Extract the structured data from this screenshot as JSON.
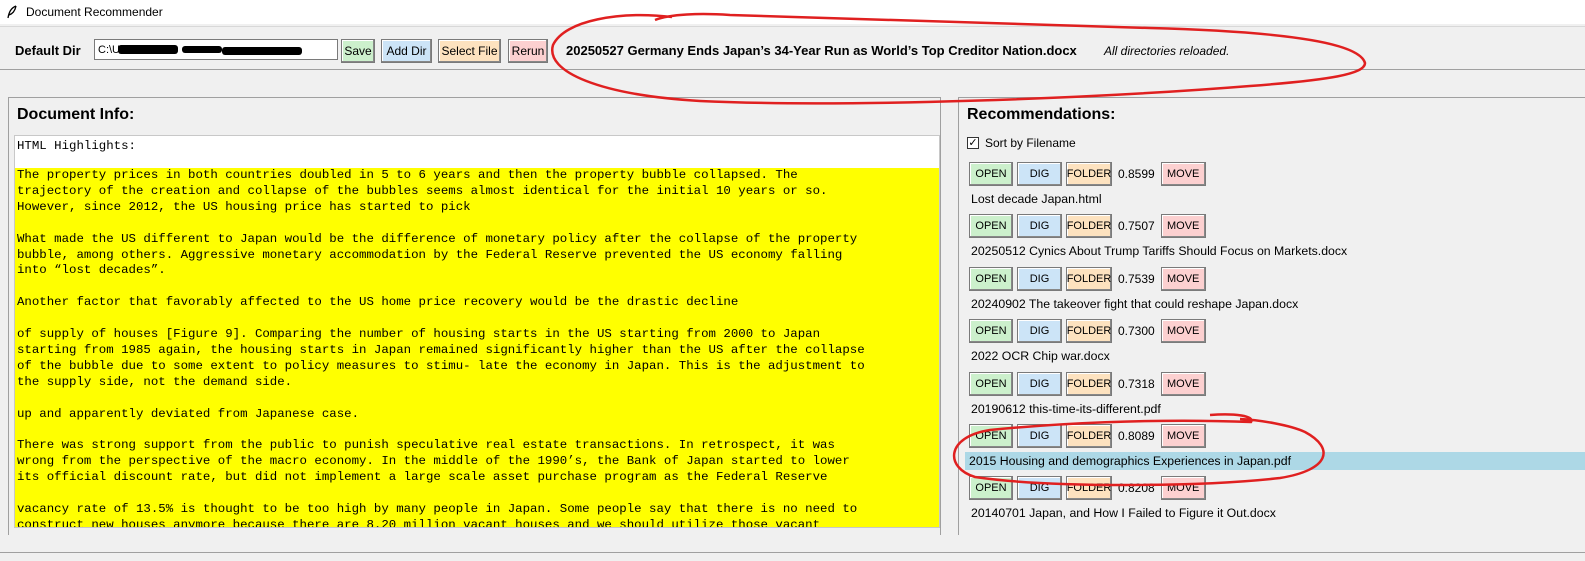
{
  "window": {
    "title": "Document Recommender",
    "icon": "feather-icon"
  },
  "toolbar": {
    "default_dir_label": "Default Dir",
    "default_dir_value": "C:\\U",
    "save_label": "Save",
    "add_dir_label": "Add Dir",
    "select_file_label": "Select File",
    "rerun_label": "Rerun",
    "current_file": "20250527 Germany Ends Japan’s 34-Year Run as World’s Top Creditor Nation.docx",
    "status": "All directories reloaded.",
    "colors": {
      "save": "#ccf0cc",
      "add_dir": "#cce4f7",
      "select_file": "#fde2bf",
      "rerun": "#fcd0d0"
    }
  },
  "document_info": {
    "heading": "Document Info:",
    "text_header": "HTML Highlights:",
    "highlight_color": "#ffff00",
    "paragraphs": [
      [
        "The property prices in both countries doubled in 5 to 6 years and then the property bubble collapsed. The",
        "trajectory of the creation and collapse of the bubbles seems almost identical for the initial 10 years or so.",
        "However, since 2012, the US housing price has started to pick"
      ],
      [
        "What made the US different to Japan would be the difference of monetary policy after the collapse of the property",
        "bubble, among others. Aggressive monetary accommodation by the Federal Reserve prevented the US economy falling",
        "into “lost decades”."
      ],
      [
        "Another factor that favorably affected to the US home price recovery would be the drastic decline"
      ],
      [
        "of supply of houses [Figure 9]. Comparing the number of housing starts in the US starting from 2000 to Japan",
        "starting from 1985 again, the housing starts in Japan remained significantly higher than the US after the collapse",
        "of the bubble due to some extent to policy measures to stimu- late the economy in Japan. This is the adjustment to",
        "the supply side, not the demand side."
      ],
      [
        "up and apparently deviated from Japanese case."
      ],
      [
        "There was strong support from the public to punish speculative real estate transactions. In retrospect, it was",
        "wrong from the perspective of the macro economy. In the middle of the 1990’s, the Bank of Japan started to lower",
        "its official discount rate, but did not implement a large scale asset purchase program as the Federal Reserve"
      ],
      [
        "vacancy rate of 13.5% is thought to be too high by many people in Japan. Some people say that there is no need to",
        "construct new houses anymore because there are 8.20 million vacant houses and we should utilize those vacant"
      ]
    ]
  },
  "recommendations": {
    "heading": "Recommendations:",
    "sort_label": "Sort by Filename",
    "sort_checked": true,
    "button_labels": {
      "open": "OPEN",
      "dig": "DIG",
      "folder": "FOLDER",
      "move": "MOVE"
    },
    "selected_index": 5,
    "items": [
      {
        "score": "0.8599",
        "filename": "Lost decade Japan.html"
      },
      {
        "score": "0.7507",
        "filename": "20250512 Cynics About Trump Tariffs Should Focus on Markets.docx"
      },
      {
        "score": "0.7539",
        "filename": "20240902 The takeover fight that could reshape Japan.docx"
      },
      {
        "score": "0.7300",
        "filename": "2022 OCR Chip war.docx"
      },
      {
        "score": "0.7318",
        "filename": "20190612 this-time-its-different.pdf"
      },
      {
        "score": "0.8089",
        "filename": "2015 Housing and demographics Experiences in Japan.pdf"
      },
      {
        "score": "0.8208",
        "filename": "20140701 Japan, and How I Failed to Figure it Out.docx"
      }
    ]
  },
  "annotations": {
    "color": "#e02020",
    "count": 2
  }
}
